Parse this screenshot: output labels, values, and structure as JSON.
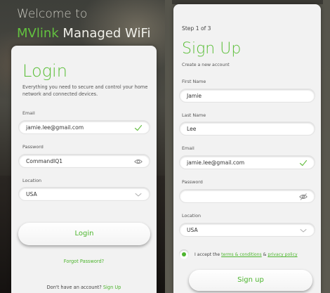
{
  "login_screen": {
    "welcome": "Welcome to",
    "brand_accent": "MVlink",
    "brand_rest": " Managed WiFi",
    "title": "Login",
    "description": "Everything you need to secure and control your home network and connected devices.",
    "email_label": "Email",
    "email_value": "jamie.lee@gmail.com",
    "password_label": "Password",
    "password_value": "CommandIQ1",
    "location_label": "Location",
    "location_value": "USA",
    "login_button": "Login",
    "forgot_password": "Forgot Password?",
    "no_account_text": "Don't have an account?",
    "sign_up_link": "Sign Up"
  },
  "signup_screen": {
    "step": "Step 1 of 3",
    "title": "Sign Up",
    "subtitle": "Create a new account",
    "first_name_label": "First Name",
    "first_name_value": "Jamie",
    "last_name_label": "Last Name",
    "last_name_value": "Lee",
    "email_label": "Email",
    "email_value": "jamie.lee@gmail.com",
    "password_label": "Password",
    "password_value": "",
    "location_label": "Location",
    "location_value": "USA",
    "accept_prefix": "I accept the",
    "terms_link": "terms & conditions",
    "amp": "&",
    "privacy_link": "privacy policy",
    "signup_button": "Sign up"
  },
  "colors": {
    "accent": "#5cbf3a",
    "card_bg": "#f2f2f2"
  },
  "icons": {
    "valid": "checkmark-icon",
    "reveal": "eye-icon",
    "hidden": "eye-slash-icon",
    "dropdown": "chevron-down-icon"
  }
}
